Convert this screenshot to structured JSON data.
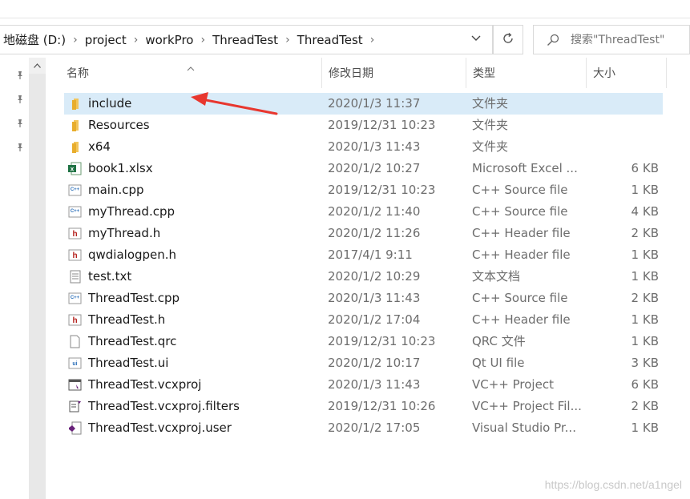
{
  "breadcrumb": [
    "地磁盘 (D:)",
    "project",
    "workPro",
    "ThreadTest",
    "ThreadTest"
  ],
  "search": {
    "placeholder": "搜索\"ThreadTest\""
  },
  "columns": {
    "name": "名称",
    "date": "修改日期",
    "type": "类型",
    "size": "大小"
  },
  "files": [
    {
      "name": "include",
      "date": "2020/1/3 11:37",
      "type": "文件夹",
      "size": "",
      "icon": "folder-icon",
      "selected": true
    },
    {
      "name": "Resources",
      "date": "2019/12/31 10:23",
      "type": "文件夹",
      "size": "",
      "icon": "folder-icon"
    },
    {
      "name": "x64",
      "date": "2020/1/3 11:43",
      "type": "文件夹",
      "size": "",
      "icon": "folder-icon"
    },
    {
      "name": "book1.xlsx",
      "date": "2020/1/2 10:27",
      "type": "Microsoft Excel ...",
      "size": "6 KB",
      "icon": "excel-file-icon"
    },
    {
      "name": "main.cpp",
      "date": "2019/12/31 10:23",
      "type": "C++ Source file",
      "size": "1 KB",
      "icon": "cpp-file-icon"
    },
    {
      "name": "myThread.cpp",
      "date": "2020/1/2 11:40",
      "type": "C++ Source file",
      "size": "4 KB",
      "icon": "cpp-file-icon"
    },
    {
      "name": "myThread.h",
      "date": "2020/1/2 11:26",
      "type": "C++ Header file",
      "size": "2 KB",
      "icon": "header-file-icon"
    },
    {
      "name": "qwdialogpen.h",
      "date": "2017/4/1 9:11",
      "type": "C++ Header file",
      "size": "1 KB",
      "icon": "header-file-icon"
    },
    {
      "name": "test.txt",
      "date": "2020/1/2 10:29",
      "type": "文本文档",
      "size": "1 KB",
      "icon": "text-file-icon"
    },
    {
      "name": "ThreadTest.cpp",
      "date": "2020/1/3 11:43",
      "type": "C++ Source file",
      "size": "2 KB",
      "icon": "cpp-file-icon"
    },
    {
      "name": "ThreadTest.h",
      "date": "2020/1/2 17:04",
      "type": "C++ Header file",
      "size": "1 KB",
      "icon": "header-file-icon"
    },
    {
      "name": "ThreadTest.qrc",
      "date": "2019/12/31 10:23",
      "type": "QRC 文件",
      "size": "1 KB",
      "icon": "blank-file-icon"
    },
    {
      "name": "ThreadTest.ui",
      "date": "2020/1/2 10:17",
      "type": "Qt UI file",
      "size": "3 KB",
      "icon": "ui-file-icon"
    },
    {
      "name": "ThreadTest.vcxproj",
      "date": "2020/1/3 11:43",
      "type": "VC++ Project",
      "size": "6 KB",
      "icon": "vcxproj-file-icon"
    },
    {
      "name": "ThreadTest.vcxproj.filters",
      "date": "2019/12/31 10:26",
      "type": "VC++ Project Fil...",
      "size": "2 KB",
      "icon": "filters-file-icon"
    },
    {
      "name": "ThreadTest.vcxproj.user",
      "date": "2020/1/2 17:05",
      "type": "Visual Studio Pr...",
      "size": "1 KB",
      "icon": "vs-user-file-icon"
    }
  ],
  "watermark": "https://blog.csdn.net/a1ngel",
  "colors": {
    "selection": "#d9ebf8",
    "folder": "#f2c55c",
    "arrow": "#e8372f"
  }
}
